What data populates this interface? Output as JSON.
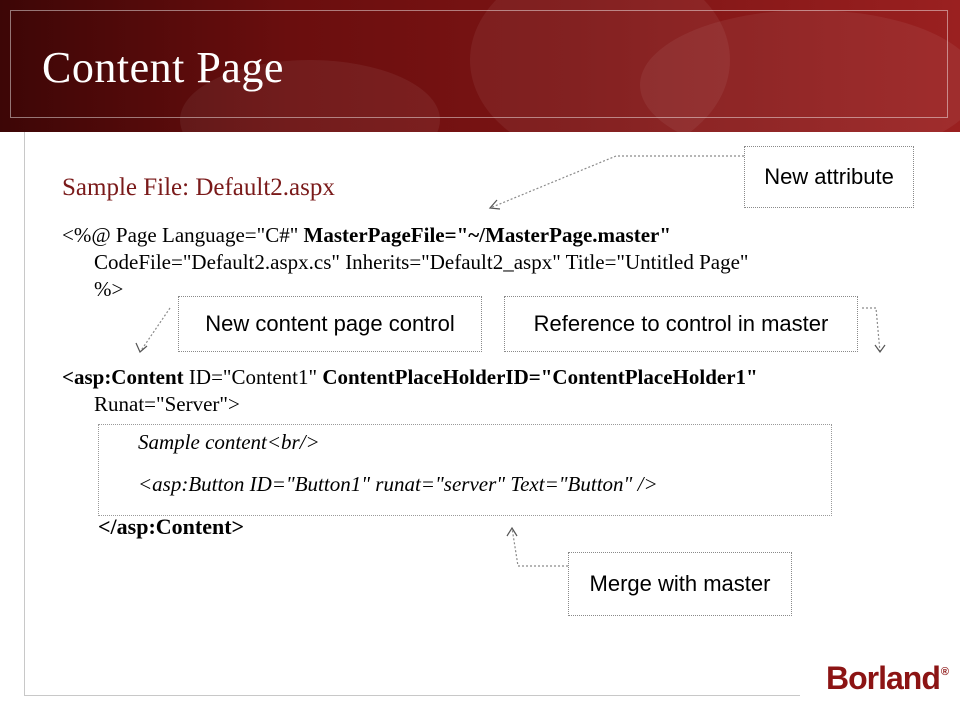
{
  "slide": {
    "title": "Content Page",
    "subtitle": "Sample File: Default2.aspx"
  },
  "code": {
    "line1_open": "<%@ Page Language=\"C#\" ",
    "line1_bold": "MasterPageFile=\"~/MasterPage.master\"",
    "line1_cont": "CodeFile=\"Default2.aspx.cs\" Inherits=\"Default2_aspx\" Title=\"Untitled Page\"",
    "line1_close": "%>",
    "line2_tag": "<asp:Content",
    "line2_id": " ID=\"Content1\" ",
    "line2_bold": "ContentPlaceHolderID=\"ContentPlaceHolder1\"",
    "line2_cont": "Runat=\"Server\">",
    "sample_content": "Sample content<br/>",
    "button_tag": "<asp:Button ID=\"Button1\" runat=\"server\" Text=\"Button\" />",
    "close_tag": "</asp:Content>"
  },
  "callouts": {
    "new_attribute": "New attribute",
    "new_content_control": "New content page control",
    "reference_master": "Reference to control in master",
    "merge_master": "Merge with master"
  },
  "brand": {
    "logo_text": "Borland",
    "logo_mark": "®",
    "accent": "#7a1a1a",
    "header_color": "#6a0e0e"
  }
}
